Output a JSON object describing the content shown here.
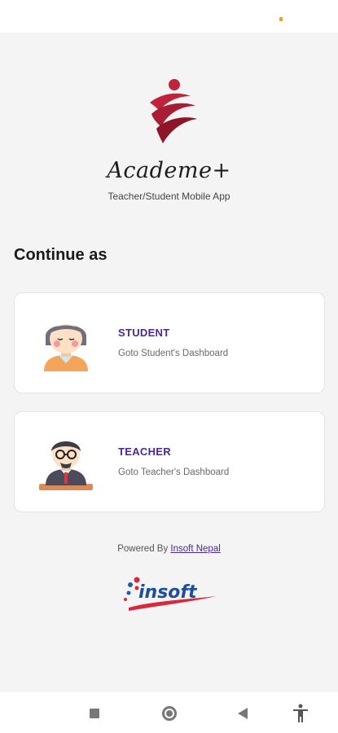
{
  "app": {
    "name": "Academe+",
    "subtitle": "Teacher/Student Mobile App"
  },
  "main": {
    "heading": "Continue as",
    "options": [
      {
        "title": "STUDENT",
        "description": "Goto Student's Dashboard"
      },
      {
        "title": "TEACHER",
        "description": "Goto Teacher's Dashboard"
      }
    ]
  },
  "footer": {
    "powered_by": "Powered By ",
    "company_link": "Insoft Nepal",
    "logo_text": "insoft"
  },
  "colors": {
    "accent": "#4b2a8a",
    "logo_red": "#b81f3a",
    "background": "#f4f4f4"
  },
  "nav": {
    "icons": [
      "recents-icon",
      "home-icon",
      "back-icon",
      "accessibility-icon"
    ]
  }
}
